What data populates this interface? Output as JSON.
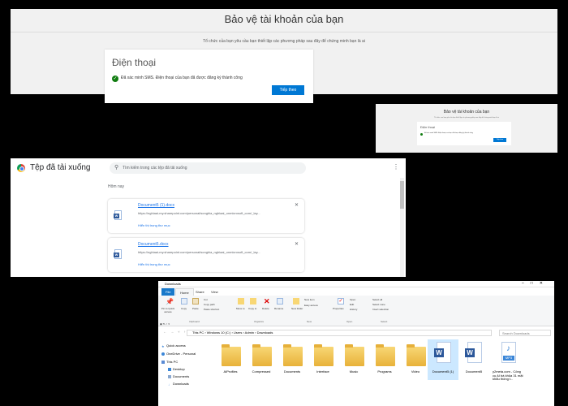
{
  "auth_large": {
    "title": "Bảo vệ tài khoản của bạn",
    "subtitle": "Tổ chức của bạn yêu cầu bạn thiết lập các phương pháp sau đây để chứng minh bạn là ai",
    "card_heading": "Điện thoại",
    "message": "Đã xác minh SMS. Điện thoại của bạn đã được đăng ký thành công",
    "next_button": "Tiếp theo"
  },
  "auth_small": {
    "title": "Bảo vệ tài khoản của bạn",
    "subtitle": "Tổ chức của bạn yêu cầu bạn thiết lập các phương pháp sau đây để chứng minh bạn là ai",
    "card_heading": "Điện thoại",
    "message": "Đã xác minh SMS. Điện thoại của bạn đã được đăng ký thành công",
    "next_button": "Tiếp theo"
  },
  "downloads": {
    "title": "Tệp đã tải xuống",
    "search_placeholder": "Tìm kiếm trong các tệp đã tải xuống",
    "section": "Hôm nay",
    "items": [
      {
        "name": "Document5 (1).docx",
        "url": "https://nghiaai-my.sharepoint.com/personal/songhia_nghiaai_onmicrosoft_com/_lay...",
        "show": "Hiển thị trong thư mục"
      },
      {
        "name": "Document5.docx",
        "url": "https://nghiaai-my.sharepoint.com/personal/songhia_nghiaai_onmicrosoft_com/_lay...",
        "show": "Hiển thị trong thư mục"
      }
    ]
  },
  "explorer": {
    "title": "Downloads",
    "tabs": [
      "File",
      "Home",
      "Share",
      "View"
    ],
    "ribbon": {
      "pin": "Pin to Quick access",
      "copy": "Copy",
      "paste": "Paste",
      "cut": "Cut",
      "copy_path": "Copy path",
      "paste_shortcut": "Paste shortcut",
      "move_to": "Move to",
      "copy_to": "Copy to",
      "delete": "Delete",
      "rename": "Rename",
      "new_folder": "New folder",
      "new_item": "New item",
      "easy_access": "Easy access",
      "properties": "Properties",
      "open": "Open",
      "edit": "Edit",
      "history": "History",
      "select_all": "Select all",
      "select_none": "Select none",
      "invert_selection": "Invert selection",
      "groups": [
        "Clipboard",
        "Organize",
        "New",
        "Open",
        "Select"
      ]
    },
    "address": "This PC  ›  Windows 10 (C:)  ›  Users  ›  Admin  ›  Downloads",
    "search_placeholder": "Search Downloads",
    "nav": [
      "Quick access",
      "OneDrive - Personal",
      "This PC",
      "Desktop",
      "Documents",
      "Downloads"
    ],
    "files": [
      {
        "label": "AIProfiles",
        "kind": "folder"
      },
      {
        "label": "Compressed",
        "kind": "folder"
      },
      {
        "label": "Documents",
        "kind": "folder"
      },
      {
        "label": "Interface",
        "kind": "folder"
      },
      {
        "label": "Music",
        "kind": "folder"
      },
      {
        "label": "Programs",
        "kind": "folder"
      },
      {
        "label": "Video",
        "kind": "folder"
      },
      {
        "label": "Document5 (1)",
        "kind": "word"
      },
      {
        "label": "Document5",
        "kind": "word"
      },
      {
        "label": "y2meta.com - Công cụ AI bá khủa 31 mặt khẩu thông t...",
        "kind": "mp3"
      }
    ],
    "mp3_badge": "MP3"
  }
}
